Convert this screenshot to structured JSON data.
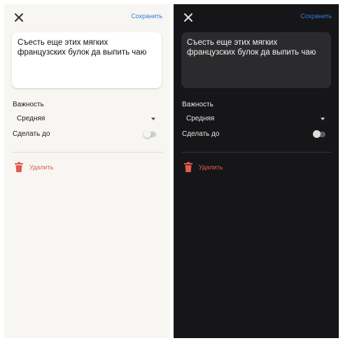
{
  "screens": {
    "light": {
      "save_label": "Сохранить",
      "task_text": "Съесть еще этих мягких французских булок да выпить чаю",
      "importance_label": "Важность",
      "importance_value": "Средняя",
      "deadline_label": "Сделать до",
      "deadline_enabled": false,
      "delete_label": "Удалить"
    },
    "dark": {
      "save_label": "Сохранить",
      "task_text": "Съесть еще этих мягких французских булок да выпить чаю",
      "importance_label": "Важность",
      "importance_value": "Средняя",
      "deadline_label": "Сделать до",
      "deadline_enabled": false,
      "delete_label": "Удалить"
    }
  },
  "icons": {
    "close": "close-icon",
    "dropdown": "chevron-down-icon",
    "delete": "trash-icon"
  },
  "colors": {
    "accent": "#2f7fd6",
    "danger": "#e05a4f",
    "light_background": "#f7f6f2",
    "dark_background": "#161618"
  }
}
